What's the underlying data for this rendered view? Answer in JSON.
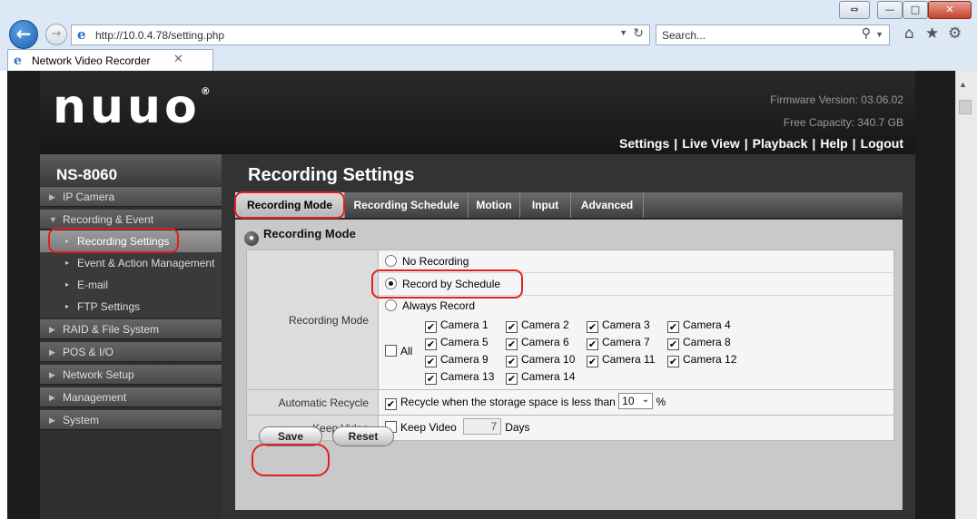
{
  "browser": {
    "url": "http://10.0.4.78/setting.php",
    "search_placeholder": "Search...",
    "tab_title": "Network Video Recorder",
    "tab_close": "✕",
    "window_buttons": {
      "restore_bar": "⇔",
      "minimize": "—",
      "maximize": "□",
      "close": "✕"
    },
    "icons": {
      "back": "arrow-left",
      "forward": "arrow-right",
      "home": "home",
      "favorites": "star",
      "tools": "gear"
    }
  },
  "header": {
    "logo": "nuuo",
    "logo_mark": "®",
    "firmware": "Firmware Version: 03.06.02",
    "capacity": "Free Capacity: 340.7 GB",
    "nav": [
      "Settings",
      "Live View",
      "Playback",
      "Help",
      "Logout"
    ]
  },
  "sidebar": {
    "device": "NS-8060",
    "items": [
      {
        "label": "IP Camera"
      },
      {
        "label": "Recording & Event",
        "expanded": true
      },
      {
        "label": "Recording Settings",
        "sub": true,
        "active": true
      },
      {
        "label": "Event & Action Management",
        "sub": true
      },
      {
        "label": "E-mail",
        "sub": true
      },
      {
        "label": "FTP Settings",
        "sub": true
      },
      {
        "label": "RAID & File System"
      },
      {
        "label": "POS & I/O"
      },
      {
        "label": "Network Setup"
      },
      {
        "label": "Management"
      },
      {
        "label": "System"
      }
    ]
  },
  "content": {
    "title": "Recording Settings",
    "tabs": [
      "Recording Mode",
      "Recording Schedule",
      "Motion",
      "Input",
      "Advanced"
    ],
    "active_tab": "Recording Mode",
    "section_title": "Recording Mode",
    "recording_mode": {
      "label": "Recording Mode",
      "options": [
        "No Recording",
        "Record by Schedule",
        "Always Record"
      ],
      "selected": "Record by Schedule",
      "all_label": "All",
      "all_checked": false,
      "cameras": [
        "Camera 1",
        "Camera 2",
        "Camera 3",
        "Camera 4",
        "Camera 5",
        "Camera 6",
        "Camera 7",
        "Camera 8",
        "Camera 9",
        "Camera 10",
        "Camera 11",
        "Camera 12",
        "Camera 13",
        "Camera 14"
      ],
      "cameras_checked": true
    },
    "recycle": {
      "label": "Automatic Recycle",
      "text": "Recycle when the storage space is less than",
      "value": "10",
      "unit": "%",
      "checked": true
    },
    "keep_video": {
      "label": "Keep Video",
      "checkbox_label": "Keep Video",
      "value": "7",
      "unit": "Days",
      "checked": false
    },
    "buttons": {
      "save": "Save",
      "reset": "Reset"
    }
  },
  "colors": {
    "highlight": "#e02020",
    "page_bg": "#333333",
    "panel_bg": "#c9c9c9"
  }
}
